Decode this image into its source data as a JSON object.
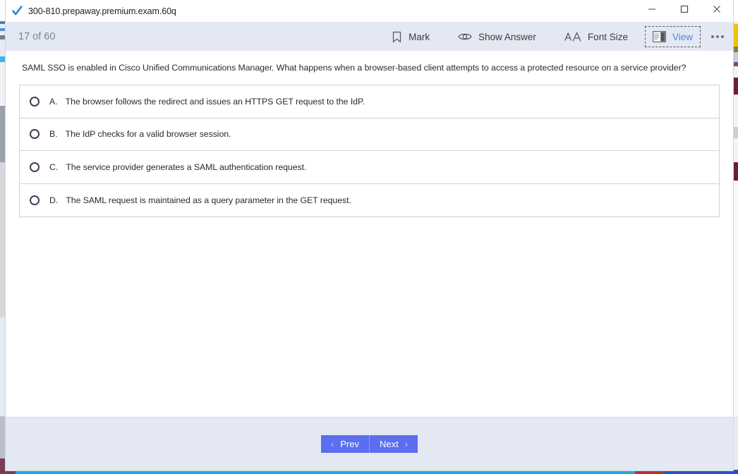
{
  "window": {
    "title": "300-810.prepaway.premium.exam.60q",
    "logo_icon": "blue-checkmark-icon",
    "controls": [
      {
        "name": "minimize",
        "icon": "minimize-icon"
      },
      {
        "name": "maximize",
        "icon": "maximize-icon"
      },
      {
        "name": "close",
        "icon": "close-icon"
      }
    ]
  },
  "toolbar": {
    "counter": "17 of 60",
    "actions": [
      {
        "label": "Mark",
        "icon": "bookmark-icon",
        "focused": false
      },
      {
        "label": "Show Answer",
        "icon": "eye-icon",
        "focused": false
      },
      {
        "label": "Font Size",
        "icon": "font-size-icon",
        "focused": false
      },
      {
        "label": "View",
        "icon": "view-panel-icon",
        "focused": true
      }
    ],
    "more_label": "more-options",
    "more_icon": "ellipsis-icon"
  },
  "question": {
    "text": "SAML SSO is enabled in Cisco Unified Communications Manager. What happens when a browser-based client attempts to access a protected resource on a service provider?",
    "options": [
      {
        "letter": "A.",
        "text": "The browser follows the redirect and issues an HTTPS GET request to the IdP.",
        "selected": false
      },
      {
        "letter": "B.",
        "text": "The IdP checks for a valid browser session.",
        "selected": false
      },
      {
        "letter": "C.",
        "text": "The service provider generates a SAML authentication request.",
        "selected": false
      },
      {
        "letter": "D.",
        "text": "The SAML request is maintained as a query parameter in the GET request.",
        "selected": false
      }
    ]
  },
  "footer": {
    "prev_label": "Prev",
    "next_label": "Next",
    "prev_chevron": "‹",
    "next_chevron": "›"
  },
  "colors": {
    "accent_blue": "#5b6ef0",
    "toolbar_bg": "#e3e8f2",
    "focus_text": "#5b7fe8",
    "counter_text": "#7a8699",
    "option_border": "#ccd3e0"
  }
}
